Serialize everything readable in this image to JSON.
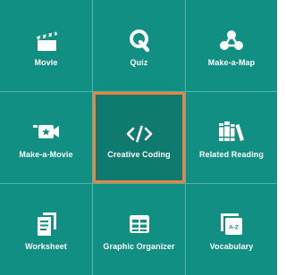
{
  "selected": "Creative Coding",
  "colors": {
    "tile_bg": "#128f83",
    "selected_bg": "#0f7a6f",
    "grid_line": "#4fb4aa",
    "highlight_border": "#f0813f",
    "text": "#ffffff"
  },
  "tiles": [
    {
      "label": "Movie",
      "icon": "clapperboard-icon"
    },
    {
      "label": "Quiz",
      "icon": "quiz-q-icon"
    },
    {
      "label": "Make-a-Map",
      "icon": "map-nodes-icon"
    },
    {
      "label": "Make-a-Movie",
      "icon": "video-camera-star-icon"
    },
    {
      "label": "Creative Coding",
      "icon": "code-brackets-icon"
    },
    {
      "label": "Related Reading",
      "icon": "books-icon"
    },
    {
      "label": "Worksheet",
      "icon": "worksheet-pages-icon"
    },
    {
      "label": "Graphic Organizer",
      "icon": "table-grid-icon"
    },
    {
      "label": "Vocabulary",
      "icon": "vocabulary-cards-icon",
      "badge": "A-Z"
    }
  ]
}
